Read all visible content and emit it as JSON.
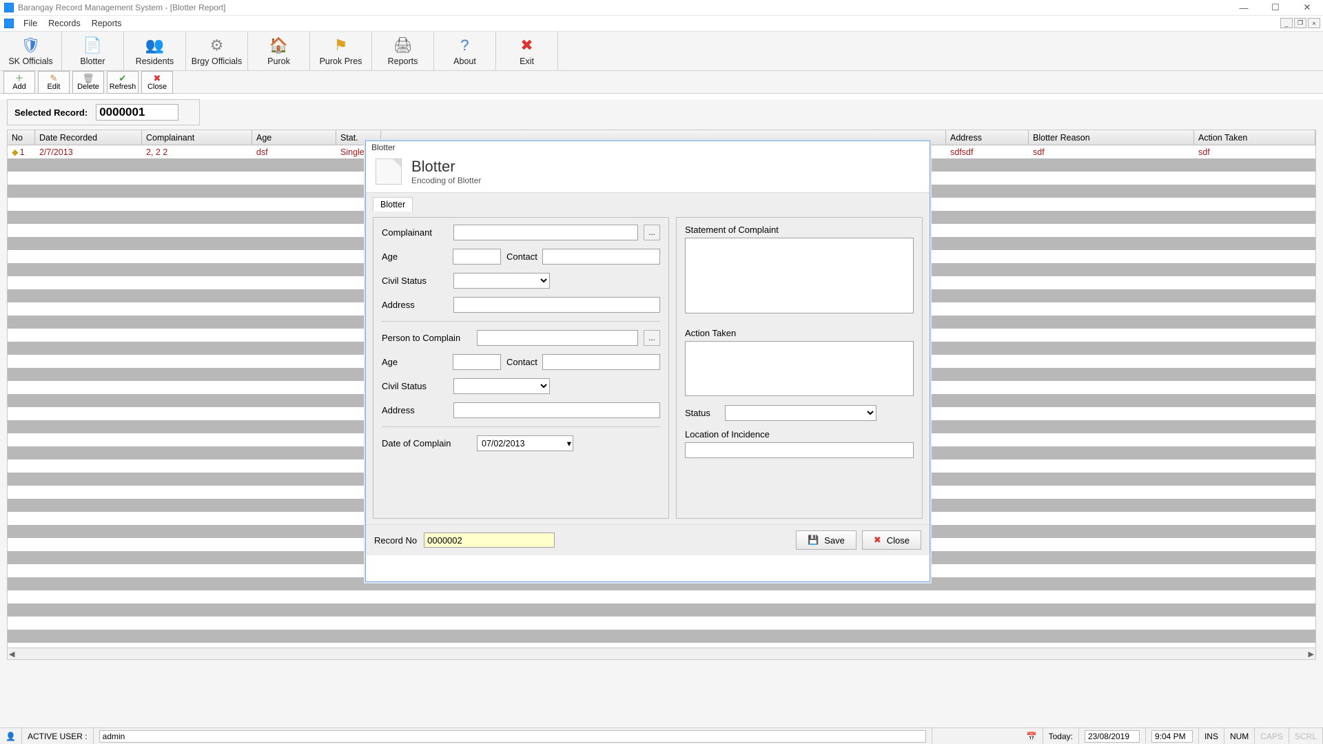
{
  "window": {
    "title": "Barangay Record Management System - [Blotter Report]"
  },
  "menubar": {
    "items": [
      "File",
      "Records",
      "Reports"
    ]
  },
  "maintoolbar": {
    "items": [
      {
        "label": "SK Officials",
        "icon": "🛡",
        "cls": "ico-shield",
        "name": "sk-officials-button"
      },
      {
        "label": "Blotter",
        "icon": "📄",
        "cls": "ico-doc",
        "name": "blotter-button"
      },
      {
        "label": "Residents",
        "icon": "👥",
        "cls": "ico-users",
        "name": "residents-button"
      },
      {
        "label": "Brgy Officials",
        "icon": "⚙",
        "cls": "ico-gear",
        "name": "brgy-officials-button"
      },
      {
        "label": "Purok",
        "icon": "🏠",
        "cls": "ico-home",
        "name": "purok-button"
      },
      {
        "label": "Purok Pres",
        "icon": "⚑",
        "cls": "ico-flag",
        "name": "purok-pres-button"
      },
      {
        "label": "Reports",
        "icon": "🖨",
        "cls": "ico-printer",
        "name": "reports-button"
      },
      {
        "label": "About",
        "icon": "?",
        "cls": "ico-help",
        "name": "about-button"
      },
      {
        "label": "Exit",
        "icon": "✖",
        "cls": "ico-exit",
        "name": "exit-button"
      }
    ]
  },
  "subtoolbar": {
    "items": [
      {
        "label": "Add",
        "icon": "＋",
        "cls": "ico-add",
        "name": "add-button"
      },
      {
        "label": "Edit",
        "icon": "✎",
        "cls": "ico-edit",
        "name": "edit-button"
      },
      {
        "label": "Delete",
        "icon": "🗑",
        "cls": "ico-del",
        "name": "delete-button"
      },
      {
        "label": "Refresh",
        "icon": "✔",
        "cls": "ico-ok",
        "name": "refresh-button"
      },
      {
        "label": "Close",
        "icon": "✖",
        "cls": "ico-close",
        "name": "close-button"
      }
    ]
  },
  "selectedRecord": {
    "label": "Selected Record:",
    "value": "0000001"
  },
  "table": {
    "headers": [
      "No",
      "Date Recorded",
      "Complainant",
      "Age",
      "Stat.",
      "",
      "Address",
      "Blotter Reason",
      "Action Taken"
    ],
    "rows": [
      {
        "no": "1",
        "date": "2/7/2013",
        "comp": "2, 2 2",
        "age": "dsf",
        "stat": "Single",
        "addr": "sdfsdf",
        "reason": "sdf",
        "action": "sdf"
      }
    ]
  },
  "dialog": {
    "frameTitle": "Blotter",
    "heading": "Blotter",
    "subheading": "Encoding of Blotter",
    "tab": "Blotter",
    "left": {
      "complainant_lbl": "Complainant",
      "age_lbl": "Age",
      "contact_lbl": "Contact",
      "civilstatus_lbl": "Civil Status",
      "address_lbl": "Address",
      "person_lbl": "Person to Complain",
      "age2_lbl": "Age",
      "contact2_lbl": "Contact",
      "civilstatus2_lbl": "Civil Status",
      "address2_lbl": "Address",
      "date_lbl": "Date of Complain",
      "date_val": "07/02/2013"
    },
    "right": {
      "statement_lbl": "Statement of   Complaint",
      "action_lbl": "Action Taken",
      "status_lbl": "Status",
      "location_lbl": "Location of  Incidence"
    },
    "footer": {
      "recordno_lbl": "Record No",
      "recordno_val": "0000002",
      "save": "Save",
      "close": "Close"
    }
  },
  "statusbar": {
    "active_user_lbl": "ACTIVE USER :",
    "active_user": "admin",
    "today_lbl": "Today:",
    "date": "23/08/2019",
    "time": "9:04 PM",
    "ins": "INS",
    "num": "NUM",
    "caps": "CAPS",
    "scrl": "SCRL"
  }
}
